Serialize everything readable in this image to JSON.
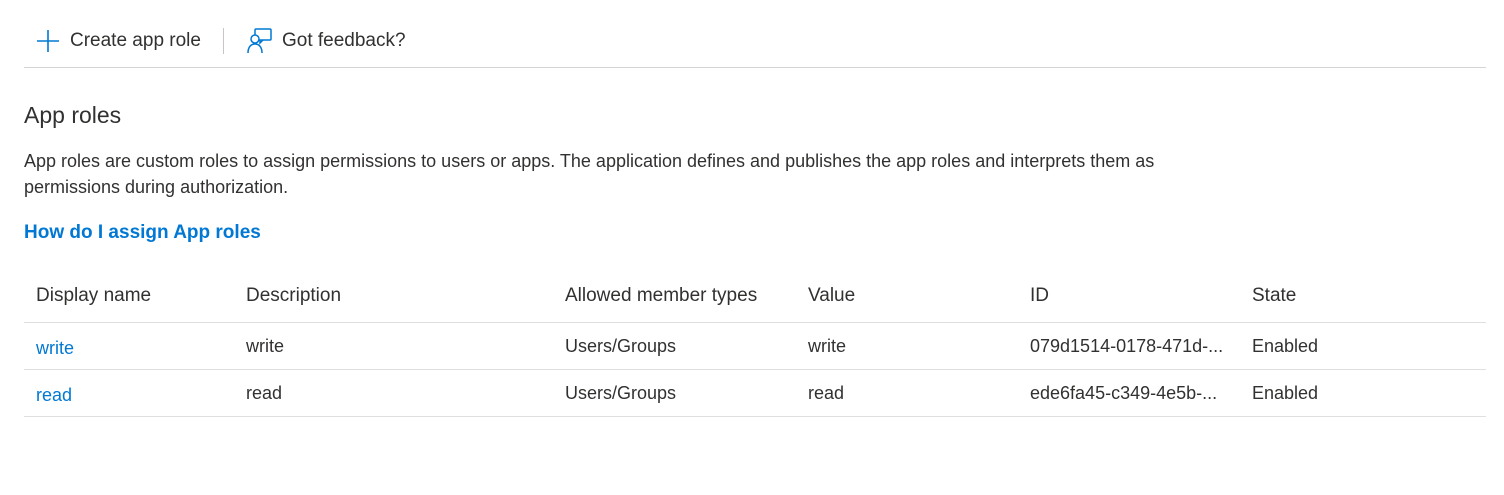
{
  "toolbar": {
    "create_label": "Create app role",
    "feedback_label": "Got feedback?"
  },
  "section": {
    "title": "App roles",
    "description": "App roles are custom roles to assign permissions to users or apps. The application defines and publishes the app roles and interprets them as permissions during authorization.",
    "help_link": "How do I assign App roles"
  },
  "table": {
    "headers": {
      "display_name": "Display name",
      "description": "Description",
      "allowed_member_types": "Allowed member types",
      "value": "Value",
      "id": "ID",
      "state": "State"
    },
    "rows": [
      {
        "display_name": "write",
        "description": "write",
        "allowed_member_types": "Users/Groups",
        "value": "write",
        "id": "079d1514-0178-471d-...",
        "state": "Enabled"
      },
      {
        "display_name": "read",
        "description": "read",
        "allowed_member_types": "Users/Groups",
        "value": "read",
        "id": "ede6fa45-c349-4e5b-...",
        "state": "Enabled"
      }
    ]
  },
  "colors": {
    "accent": "#0078d4",
    "text": "#323130",
    "border": "#e1dfdd"
  }
}
